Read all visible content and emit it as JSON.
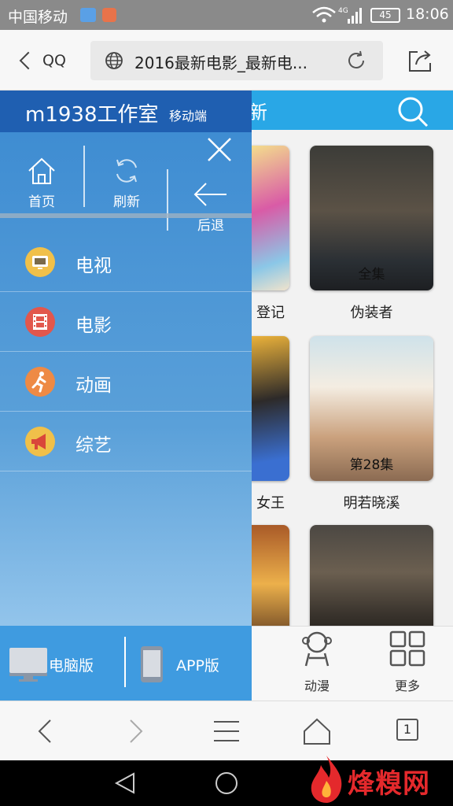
{
  "status": {
    "carrier": "中国移动",
    "network": "4G",
    "battery": "45",
    "time": "18:06"
  },
  "browser": {
    "back_label": "QQ",
    "url": "2016最新电影_最新电..."
  },
  "drawer": {
    "site_name": "m1938工作室",
    "site_sub": "移动端",
    "quick_actions": {
      "home": "首页",
      "refresh": "刷新",
      "back": "后退"
    },
    "menu": [
      {
        "label": "电视",
        "icon": "tv-icon",
        "color": "#f0c04a"
      },
      {
        "label": "电影",
        "icon": "film-icon",
        "color": "#e2574c"
      },
      {
        "label": "动画",
        "icon": "running-icon",
        "color": "#ee8a45"
      },
      {
        "label": "综艺",
        "icon": "megaphone-icon",
        "color": "#f0c04a"
      }
    ],
    "footer": {
      "pc": "电脑版",
      "app": "APP版"
    }
  },
  "page": {
    "header_fragment": "新",
    "posters": [
      {
        "title": "登记",
        "episode": ""
      },
      {
        "title": "伪装者",
        "episode": "全集"
      },
      {
        "title": "女王",
        "episode": ""
      },
      {
        "title": "明若晓溪",
        "episode": "第28集"
      },
      {
        "title": "",
        "episode": ""
      },
      {
        "title": "",
        "episode": ""
      }
    ],
    "tabs": {
      "anime": "动漫",
      "more": "更多"
    }
  },
  "toolbar": {
    "tab_count": "1"
  },
  "watermark": "烽糗网"
}
